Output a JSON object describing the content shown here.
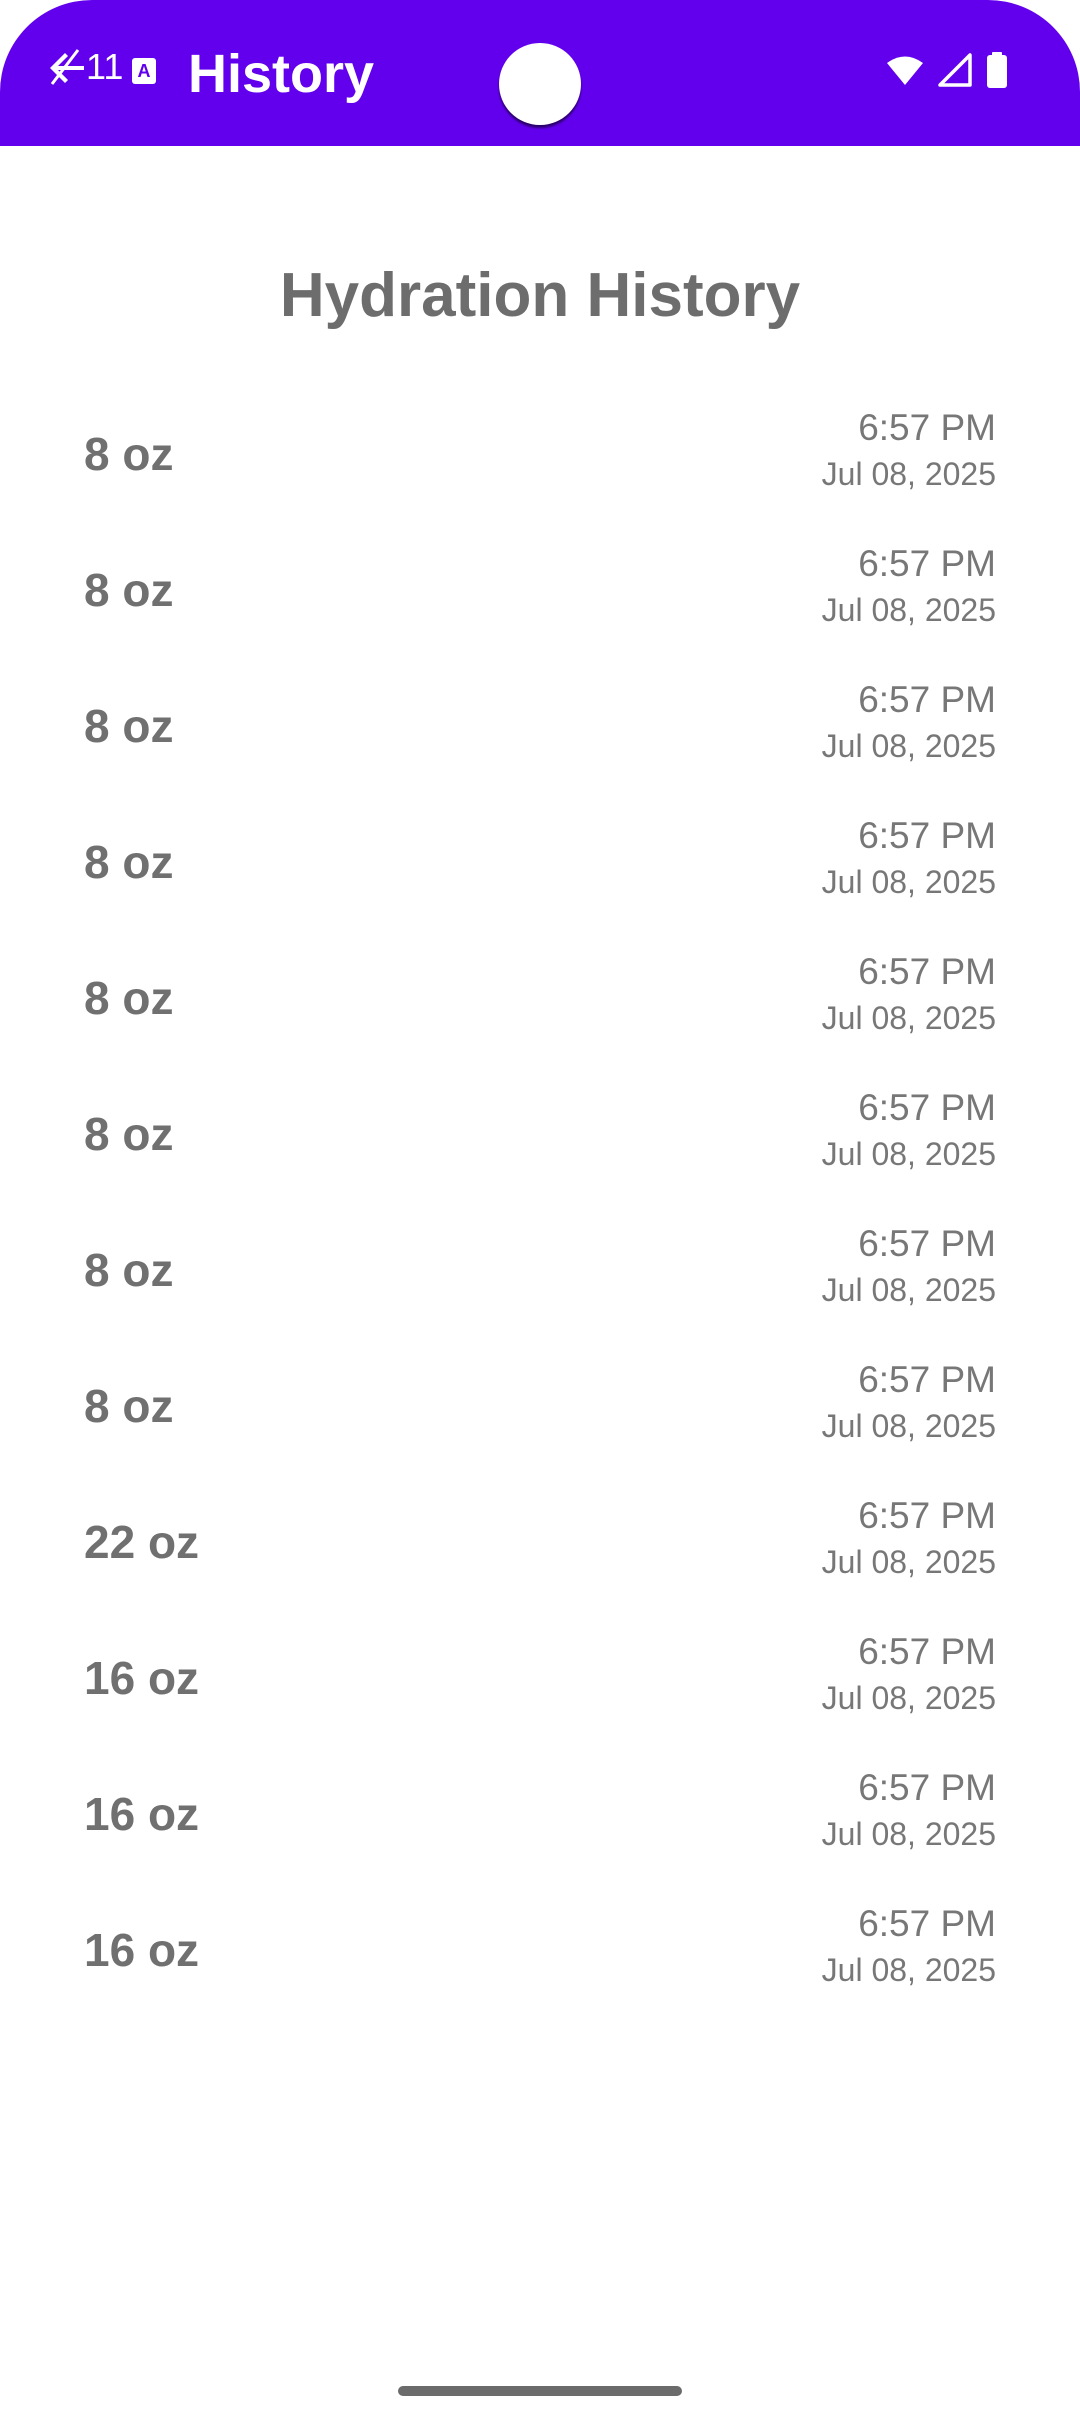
{
  "status_bar": {
    "time": "11"
  },
  "app_bar": {
    "title": "History"
  },
  "page": {
    "heading": "Hydration History"
  },
  "history": [
    {
      "amount": "8 oz",
      "time": "6:57 PM",
      "date": "Jul 08, 2025"
    },
    {
      "amount": "8 oz",
      "time": "6:57 PM",
      "date": "Jul 08, 2025"
    },
    {
      "amount": "8 oz",
      "time": "6:57 PM",
      "date": "Jul 08, 2025"
    },
    {
      "amount": "8 oz",
      "time": "6:57 PM",
      "date": "Jul 08, 2025"
    },
    {
      "amount": "8 oz",
      "time": "6:57 PM",
      "date": "Jul 08, 2025"
    },
    {
      "amount": "8 oz",
      "time": "6:57 PM",
      "date": "Jul 08, 2025"
    },
    {
      "amount": "8 oz",
      "time": "6:57 PM",
      "date": "Jul 08, 2025"
    },
    {
      "amount": "8 oz",
      "time": "6:57 PM",
      "date": "Jul 08, 2025"
    },
    {
      "amount": "22 oz",
      "time": "6:57 PM",
      "date": "Jul 08, 2025"
    },
    {
      "amount": "16 oz",
      "time": "6:57 PM",
      "date": "Jul 08, 2025"
    },
    {
      "amount": "16 oz",
      "time": "6:57 PM",
      "date": "Jul 08, 2025"
    },
    {
      "amount": "16 oz",
      "time": "6:57 PM",
      "date": "Jul 08, 2025"
    }
  ],
  "icons": {
    "back": "back-arrow-icon",
    "notification": "app-notification-icon",
    "wifi": "wifi-icon",
    "signal": "signal-icon",
    "battery": "battery-icon"
  },
  "colors": {
    "app_bar": "#6200EE",
    "heading": "#6d6d6d",
    "row_text": "#777777"
  }
}
